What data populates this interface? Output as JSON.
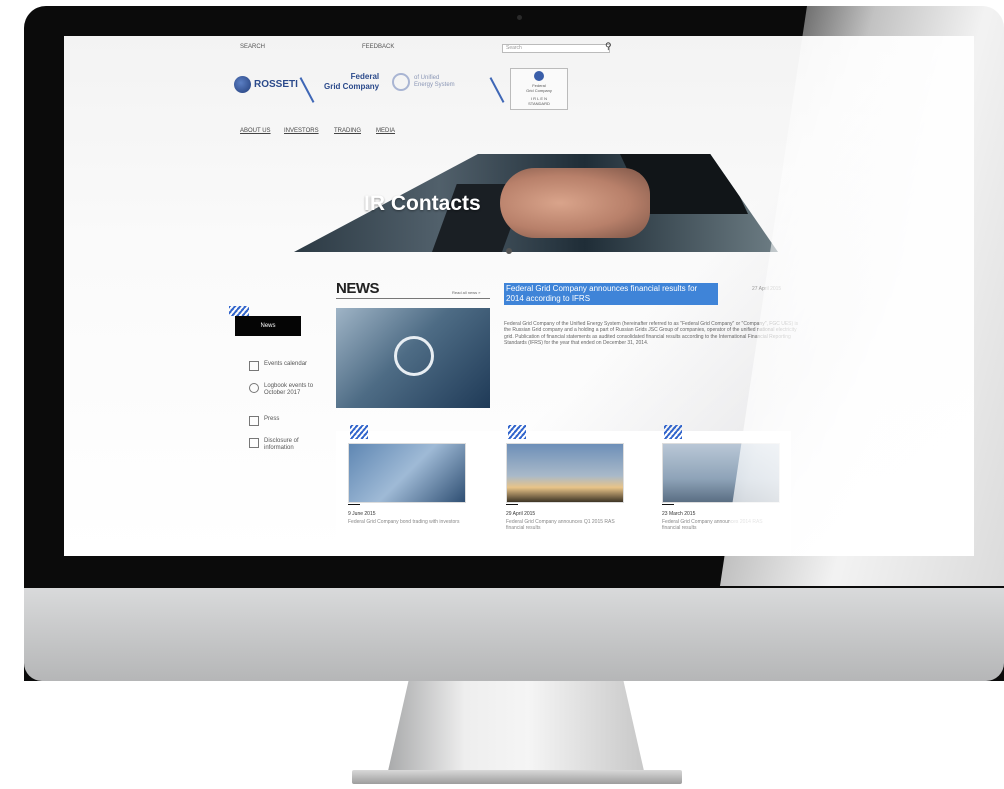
{
  "top_links": {
    "search_label": "SEARCH",
    "feedback_label": "FEEDBACK",
    "search_placeholder": "Search"
  },
  "logos": {
    "rosseti": "ROSSETI",
    "fgc_line1": "Federal",
    "fgc_line2": "Grid Company",
    "ues_line1": "of Unified",
    "ues_line2": "Energy System",
    "badge_line1": "Federal",
    "badge_line2": "Grid Company",
    "badge_line3": "I  R  L  E  N",
    "badge_line4": "STANDARD"
  },
  "nav": [
    "ABOUT US",
    "INVESTORS",
    "TRADING",
    "MEDIA"
  ],
  "hero": {
    "title": "IR Contacts"
  },
  "sidebar": {
    "active": "News",
    "items": [
      {
        "label": "Events calendar",
        "icon": "calendar-icon"
      },
      {
        "label": "Logbook events to October 2017",
        "icon": "refresh-icon"
      },
      {
        "label": "Press",
        "icon": "document-icon"
      },
      {
        "label": "Disclosure of information",
        "icon": "building-icon"
      }
    ]
  },
  "news": {
    "title": "NEWS",
    "all_link": "Read all news »",
    "headline": "Federal Grid Company announces financial results for 2014 according to IFRS",
    "date": "27 April 2015",
    "lead": "Federal Grid Company of the Unified Energy System (hereinafter referred to as \"Federal Grid Company\" or \"Company\", FGC UES) is the Russian Grid company and a holding a part of Russian Grids JSC Group of companies, operator of the unified national electricity grid. Publication of financial statements as audited consolidated financial results according to the International Financial Reporting Standards (IFRS) for the year that ended on December 31, 2014."
  },
  "cards": [
    {
      "date": "9 June 2015",
      "text": "Federal Grid Company bond trading with investors"
    },
    {
      "date": "29 April 2015",
      "text": "Federal Grid Company announces Q1 2015 RAS financial results"
    },
    {
      "date": "23 March 2015",
      "text": "Federal Grid Company announces 2014 RAS financial results"
    }
  ],
  "colors": {
    "accent": "#3f84d8",
    "brand": "#2b4a8b",
    "dark": "#050505"
  }
}
